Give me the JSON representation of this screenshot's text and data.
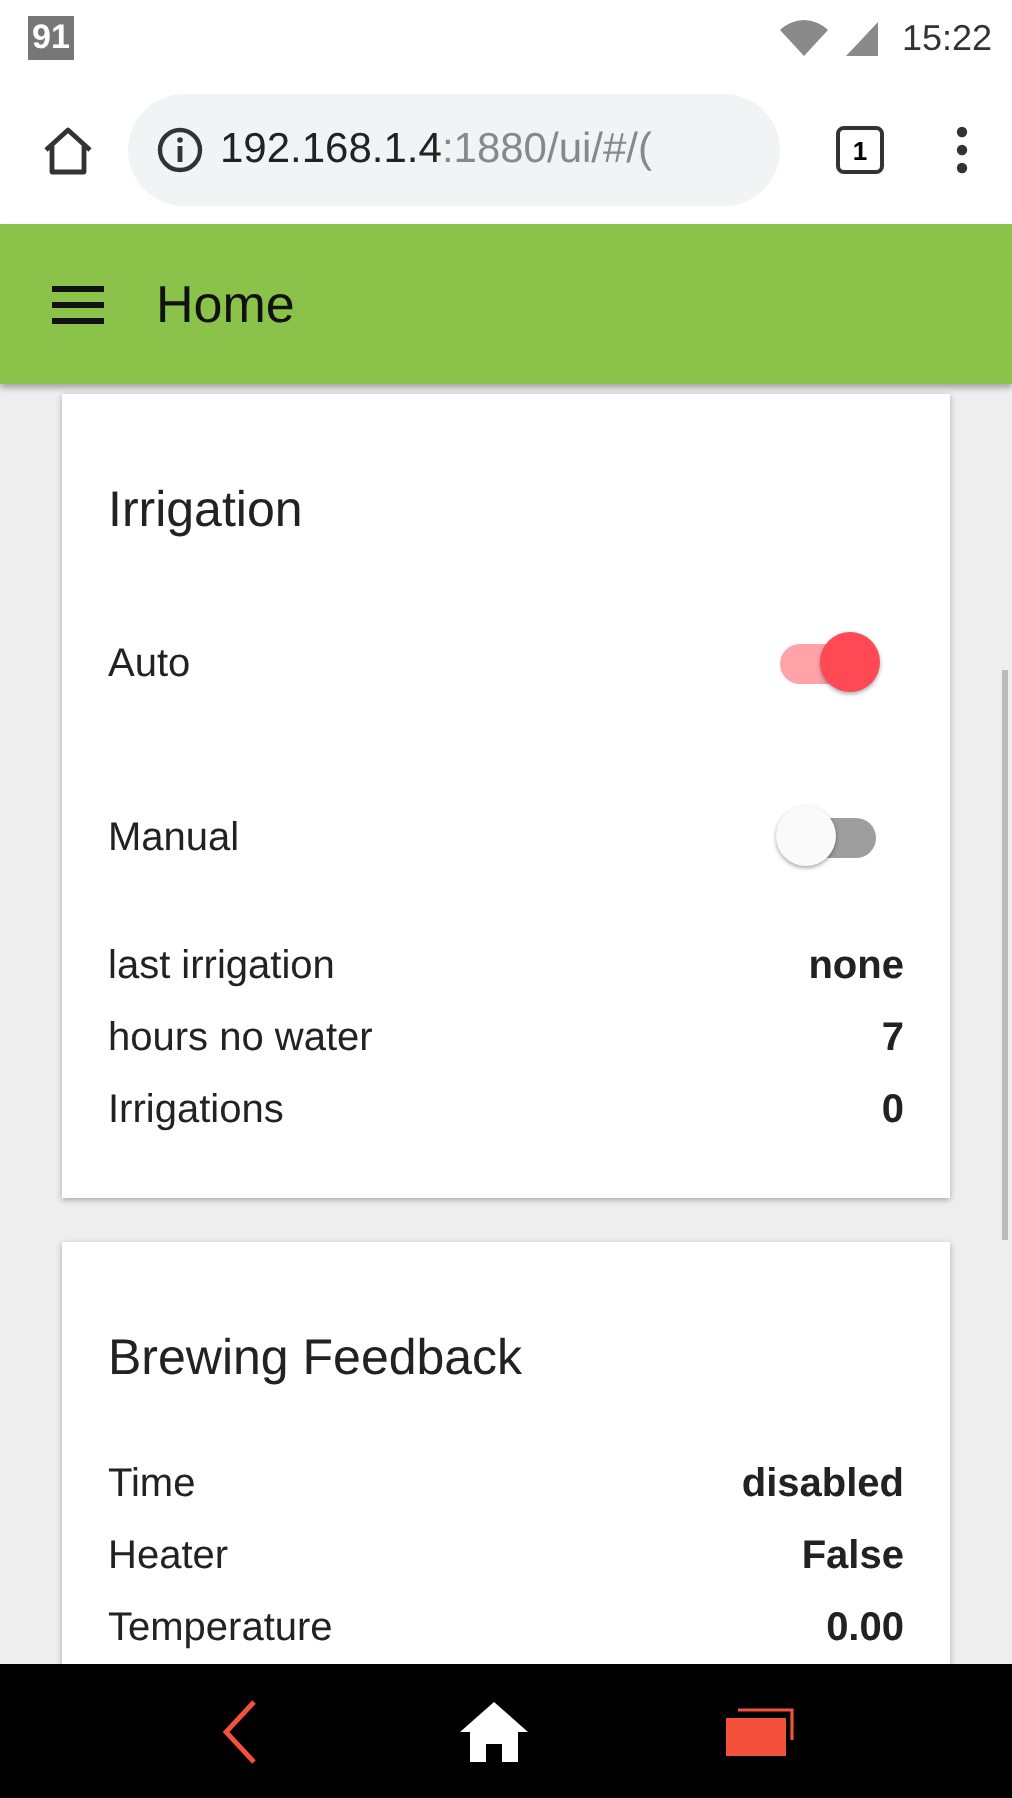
{
  "status_bar": {
    "notification": "91",
    "time": "15:22"
  },
  "browser": {
    "url_host": "192.168.1.4",
    "url_rest": ":1880/ui/#/(",
    "tab_count": "1"
  },
  "header": {
    "title": "Home"
  },
  "cards": [
    {
      "title": "Irrigation",
      "rows": [
        {
          "kind": "switch",
          "label": "Auto",
          "on": true
        },
        {
          "kind": "switch",
          "label": "Manual",
          "on": false
        },
        {
          "kind": "text",
          "label": "last irrigation",
          "value": "none"
        },
        {
          "kind": "text",
          "label": "hours no water",
          "value": "7"
        },
        {
          "kind": "text",
          "label": "Irrigations",
          "value": "0"
        }
      ]
    },
    {
      "title": "Brewing Feedback",
      "rows": [
        {
          "kind": "text",
          "label": "Time",
          "value": "disabled"
        },
        {
          "kind": "text",
          "label": "Heater",
          "value": "False"
        },
        {
          "kind": "text",
          "label": "Temperature",
          "value": "0.00"
        }
      ]
    }
  ]
}
